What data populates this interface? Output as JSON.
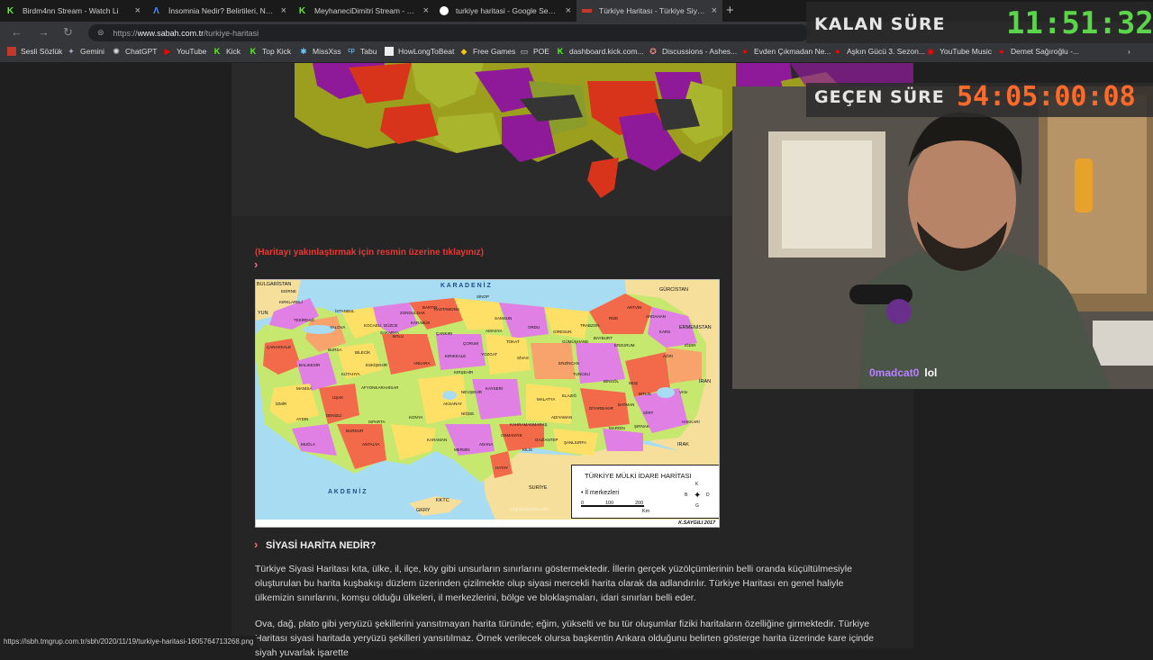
{
  "tabs": [
    {
      "title": "Birdm4nn Stream - Watch Li",
      "icon": "kick-icon",
      "color": "#53fc18"
    },
    {
      "title": "İnsomnia Nedir? Belirtileri, Neden",
      "icon": "a-icon",
      "color": "#4f8cff"
    },
    {
      "title": "MeyhaneciDimitri Stream - Watch",
      "icon": "kick-icon",
      "color": "#53fc18"
    },
    {
      "title": "turkiye haritasi - Google Search",
      "icon": "google-icon",
      "color": "#ffffff"
    },
    {
      "title": "Türkiye Haritası - Türkiye Siyasi H",
      "icon": "sabah-icon",
      "color": "#c0392b"
    }
  ],
  "address": {
    "prefix": "https://",
    "host": "www.sabah.com.tr",
    "path": "/turkiye-haritasi"
  },
  "bookmarks": [
    {
      "label": "Sesli Sözlük",
      "icon": "flag-icon"
    },
    {
      "label": "Gemini",
      "icon": "gemini-icon"
    },
    {
      "label": "ChatGPT",
      "icon": "chatgpt-icon"
    },
    {
      "label": "YouTube",
      "icon": "youtube-icon"
    },
    {
      "label": "Kick",
      "icon": "kick-icon"
    },
    {
      "label": "Top Kick",
      "icon": "kick-icon"
    },
    {
      "label": "MissXss",
      "icon": "star-icon"
    },
    {
      "label": "Tabu",
      "icon": "cp-icon"
    },
    {
      "label": "HowLongToBeat",
      "icon": "hltb-icon"
    },
    {
      "label": "Free Games",
      "icon": "tag-icon"
    },
    {
      "label": "POE",
      "icon": "folder-icon"
    },
    {
      "label": "dashboard.kick.com...",
      "icon": "kick-icon"
    },
    {
      "label": "Discussions - Ashes...",
      "icon": "steam-icon"
    },
    {
      "label": "Evden Çıkmadan Ne...",
      "icon": "youtube-icon"
    },
    {
      "label": "Aşkın Gücü 3. Sezon...",
      "icon": "youtube-icon"
    },
    {
      "label": "YouTube Music",
      "icon": "ytmusic-icon"
    },
    {
      "label": "Demet Sağıroğlu -...",
      "icon": "youtube-icon"
    }
  ],
  "article": {
    "hint": "(Haritayı yakınlaştırmak için resmin üzerine tıklayınız)",
    "map": {
      "sea_north": "K A R A D E N İ Z",
      "sea_south": "A K D E N İ Z",
      "neighbors": [
        "BULGARİSTAN",
        "YUN",
        "GÜRCİSTAN",
        "ERMENİSTAN",
        "İRAN",
        "IRAK",
        "SURİYE",
        "KKTC",
        "GKRY"
      ],
      "cities": [
        "EDİRNE",
        "KIRKLARELİ",
        "TEKİRDAĞ",
        "İSTANBUL",
        "KOCAELİ",
        "SAKARYA",
        "DÜZCE",
        "BOLU",
        "ZONGULDAK",
        "BARTIN",
        "KASTAMONU",
        "SİNOP",
        "SAMSUN",
        "ORDU",
        "GİRESUN",
        "TRABZON",
        "RİZE",
        "ARTVİN",
        "ARDAHAN",
        "KARS",
        "IĞDIR",
        "AĞRI",
        "ERZURUM",
        "BAYBURT",
        "GÜMÜŞHANE",
        "ERZİNCAN",
        "TOKAT",
        "AMASYA",
        "ÇORUM",
        "ÇANKIRI",
        "KARABÜK",
        "ANKARA",
        "KIRIKKALE",
        "YOZGAT",
        "SİVAS",
        "BURSA",
        "BİLECİK",
        "ESKİŞEHİR",
        "BALIKESİR",
        "ÇANAKKALE",
        "KÜTAHYA",
        "MANİSA",
        "İZMİR",
        "UŞAK",
        "AFYONKARAHİSAR",
        "AYDIN",
        "DENİZLİ",
        "MUĞLA",
        "BURDUR",
        "ISPARTA",
        "ANTALYA",
        "KONYA",
        "KARAMAN",
        "MERSİN",
        "ADANA",
        "HATAY",
        "OSMANİYE",
        "KAHRAMANMARAŞ",
        "GAZİANTEP",
        "KİLİS",
        "ADIYAMAN",
        "MALATYA",
        "ELAZIĞ",
        "TUNCELİ",
        "BİNGÖL",
        "MUŞ",
        "BİTLİS",
        "VAN",
        "HAKKARİ",
        "ŞIRNAK",
        "SİİRT",
        "BATMAN",
        "MARDİN",
        "DİYARBAKIR",
        "ŞANLIURFA",
        "KAYSERİ",
        "NEVŞEHİR",
        "KIRŞEHİR",
        "AKSARAY",
        "NİĞDE",
        "YALOVA"
      ],
      "legend_title": "TÜRKİYE MÜLKİ İDARE HARİTASI",
      "legend_item": "İl merkezleri",
      "scale": [
        "0",
        "100",
        "200",
        "Km"
      ],
      "compass": [
        "K",
        "B",
        "D",
        "G"
      ],
      "credit": "K.SAYGILI 2017",
      "watermark": "cografyaharita.com"
    },
    "heading": "SİYASİ HARİTA NEDİR?",
    "paragraph1": "Türkiye Siyasi Haritası kıta, ülke, il, ilçe, köy gibi unsurların sınırlarını göstermektedir. İllerin gerçek yüzölçümlerinin belli oranda küçültülmesiyle oluşturulan bu harita kuşbakışı düzlem üzerinden çizilmekte olup siyasi mercekli harita olarak da adlandırılır. Türkiye Haritası en genel haliyle ülkemizin sınırlarını, komşu olduğu ülkeleri, il merkezlerini, bölge ve bloklaşmaları, idari sınırları belli eder.",
    "paragraph2": "Ova, dağ, plato gibi yeryüzü şekillerini yansıtmayan harita türünde; eğim, yükselti ve bu tür oluşumlar fiziki haritaların özelliğine girmektedir. Türkiye Haritası siyasi haritada yeryüzü şekilleri yansıtılmaz. Örnek verilecek olursa başkentin Ankara olduğunu belirten gösterge harita üzerinde kare içinde siyah yuvarlak işarette"
  },
  "status_url": "https://isbh.tmgrup.com.tr/sbh/2020/11/19/turkiye-haritasi-1605764713268.png",
  "overlay": {
    "remaining_label": "KALAN SÜRE",
    "remaining_value": "11:51:32",
    "remaining_color": "#5bd64a",
    "elapsed_label": "GEÇEN SÜRE",
    "elapsed_value": "54:05:00:08",
    "elapsed_color": "#ff6a2a",
    "chat_user": "0madcat0",
    "chat_message": "lol"
  }
}
